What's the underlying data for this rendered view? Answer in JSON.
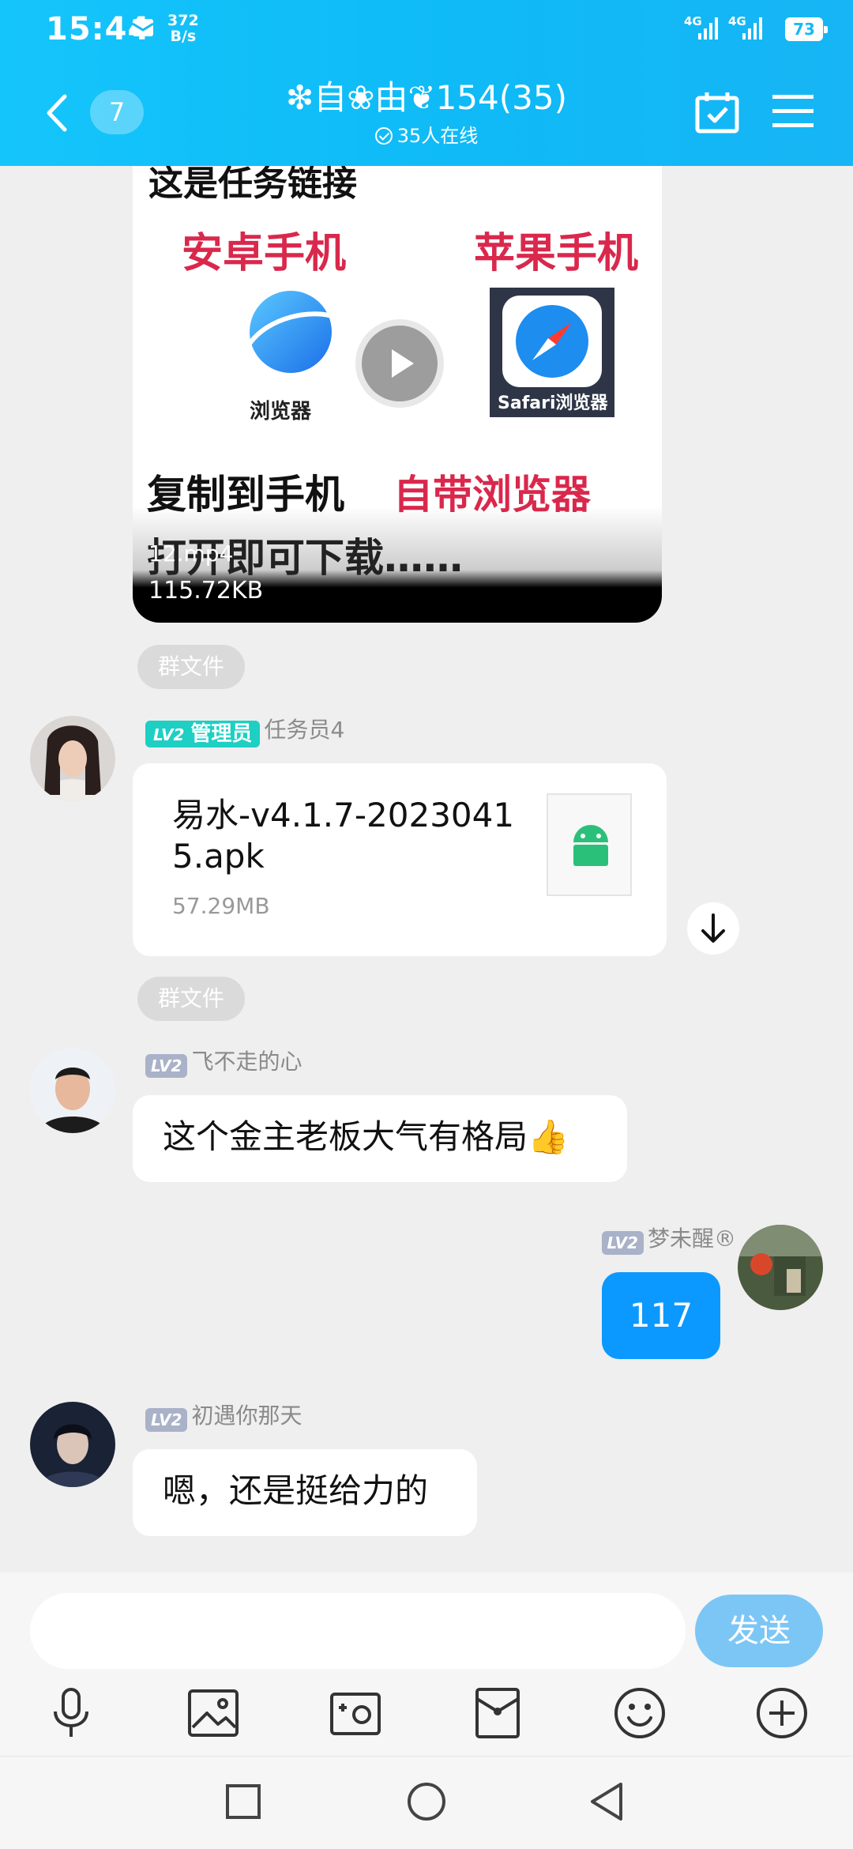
{
  "status_bar": {
    "time": "15:44",
    "net_speed_value": "372",
    "net_speed_unit": "B/s",
    "sig1": "4G",
    "sig2": "4G",
    "battery": "73"
  },
  "header": {
    "back_badge": "7",
    "title": "❇自❀由❦154(35)",
    "online": "35人在线"
  },
  "video": {
    "overlay_top": "这是任务链接",
    "android_label": "安卓手机",
    "apple_label": "苹果手机",
    "android_browser": "浏览器",
    "safari_browser": "Safari浏览器",
    "copy_to_phone": "复制到手机",
    "builtin_browser": "自带浏览器",
    "open_download": "打开即可下载……",
    "file_name": "12.mp4",
    "file_size": "115.72KB"
  },
  "group_file_tag": "群文件",
  "messages": [
    {
      "level": "LV2",
      "role": "管理员",
      "nick": "任务员4",
      "file_name": "易水-v4.1.7-20230415.apk",
      "file_size": "57.29MB"
    },
    {
      "level": "LV2",
      "nick": "飞不走的心",
      "text": "这个金主老板大气有格局👍"
    },
    {
      "level": "LV2",
      "nick": "梦未醒®",
      "text": "117",
      "mine": true
    },
    {
      "level": "LV2",
      "nick": "初遇你那天",
      "text": "嗯，还是挺给力的"
    }
  ],
  "composer": {
    "send_label": "发送",
    "input_value": ""
  },
  "icons": {
    "toolbar": [
      "microphone-icon",
      "image-icon",
      "camera-icon",
      "red-packet-icon",
      "emoji-icon",
      "plus-icon"
    ],
    "navbar": [
      "recent-apps-icon",
      "home-icon",
      "back-icon"
    ]
  },
  "colors": {
    "header": "#14c5fb",
    "my_bubble": "#0b99ff",
    "send_button": "#7cc6f6",
    "admin_badge": "#1ecfc3",
    "level_badge": "#a9b2c8"
  }
}
